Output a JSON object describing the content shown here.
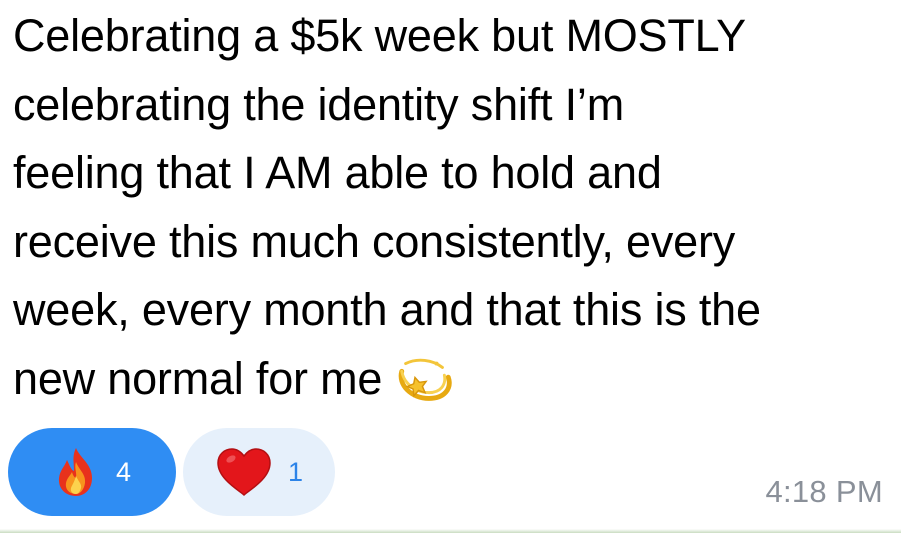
{
  "message": {
    "lines": [
      "Celebrating a $5k week but MOSTLY",
      "celebrating the identity shift I’m",
      "feeling that I AM able to hold and",
      "receive this much consistently, every",
      "week, every month and that this is the",
      "new normal for me"
    ],
    "trailing_emoji": "dizzy-star-emoji"
  },
  "reactions": [
    {
      "emoji": "fire-emoji",
      "count": "4",
      "selected": true,
      "color": "#2f8df3"
    },
    {
      "emoji": "red-heart-emoji",
      "count": "1",
      "selected": false,
      "color": "#e6f0fb"
    }
  ],
  "timestamp": "4:18 PM",
  "colors": {
    "text": "#000000",
    "timestamp": "#8a9099",
    "reaction_selected_bg": "#2f8df3",
    "reaction_unselected_bg": "#e6f0fb",
    "reaction_unselected_text": "#2c83e8"
  }
}
